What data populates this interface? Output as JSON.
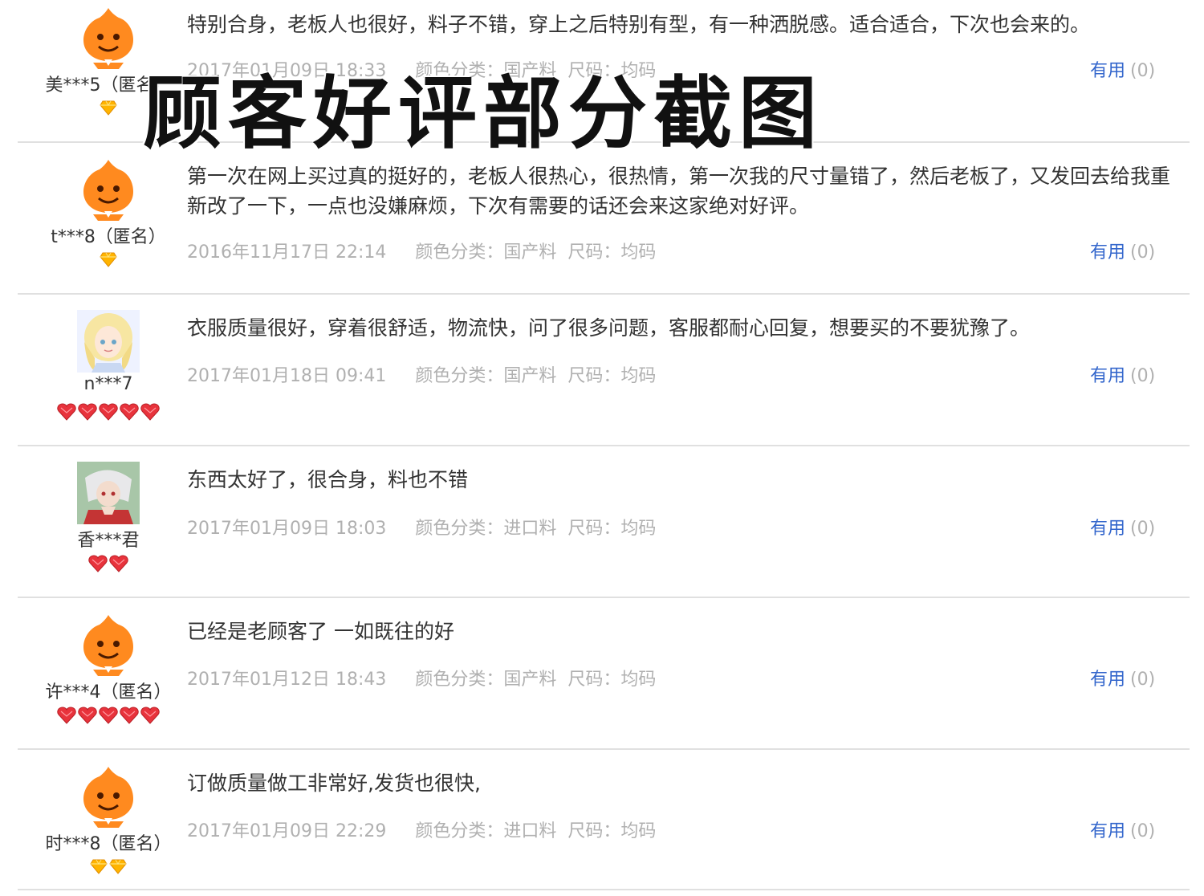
{
  "watermark": {
    "text": "顾客好评部分截图"
  },
  "colors": {
    "link_blue": "#3366cc",
    "meta_gray": "#b0b0b0",
    "text_dark": "#333333",
    "avatar_orange": "#ff8a1f",
    "gem_gold": "#ffb400",
    "gem_red": "#e8333c"
  },
  "reviews": [
    {
      "user": "美***5（匿名）",
      "avatar": "taobao-mascot-icon",
      "badge": "gold-diamond",
      "badge_count": 1,
      "text": "特别合身，老板人也很好，料子不错，穿上之后特别有型，有一种洒脱感。适合适合，下次也会来的。",
      "date": "2017年01月09日 18:33",
      "color_category": "颜色分类：国产料",
      "size": "尺码：均码",
      "useful_label": "有用",
      "useful_count": "(0)"
    },
    {
      "user": "t***8（匿名）",
      "avatar": "taobao-mascot-icon",
      "badge": "gold-diamond",
      "badge_count": 1,
      "text": "第一次在网上买过真的挺好的，老板人很热心，很热情，第一次我的尺寸量错了，然后老板了，又发回去给我重新改了一下，一点也没嫌麻烦，下次有需要的话还会来这家绝对好评。",
      "date": "2016年11月17日 22:14",
      "color_category": "颜色分类：国产料",
      "size": "尺码：均码",
      "useful_label": "有用",
      "useful_count": "(0)"
    },
    {
      "user": "n***7",
      "avatar": "anime-girl-avatar",
      "badge": "red-heart",
      "badge_count": 5,
      "text": "衣服质量很好，穿着很舒适，物流快，问了很多问题，客服都耐心回复，想要买的不要犹豫了。",
      "date": "2017年01月18日 09:41",
      "color_category": "颜色分类：国产料",
      "size": "尺码：均码",
      "useful_label": "有用",
      "useful_count": "(0)"
    },
    {
      "user": "香***君",
      "avatar": "anime-character-avatar",
      "badge": "red-heart",
      "badge_count": 2,
      "text": "东西太好了，很合身，料也不错",
      "date": "2017年01月09日 18:03",
      "color_category": "颜色分类：进口料",
      "size": "尺码：均码",
      "useful_label": "有用",
      "useful_count": "(0)"
    },
    {
      "user": "许***4（匿名）",
      "avatar": "taobao-mascot-icon",
      "badge": "red-heart",
      "badge_count": 5,
      "text": "已经是老顾客了 一如既往的好",
      "date": "2017年01月12日 18:43",
      "color_category": "颜色分类：国产料",
      "size": "尺码：均码",
      "useful_label": "有用",
      "useful_count": "(0)"
    },
    {
      "user": "时***8（匿名）",
      "avatar": "taobao-mascot-icon",
      "badge": "gold-diamond",
      "badge_count": 2,
      "text": "订做质量做工非常好,发货也很快,",
      "date": "2017年01月09日 22:29",
      "color_category": "颜色分类：进口料",
      "size": "尺码：均码",
      "useful_label": "有用",
      "useful_count": "(0)"
    }
  ]
}
